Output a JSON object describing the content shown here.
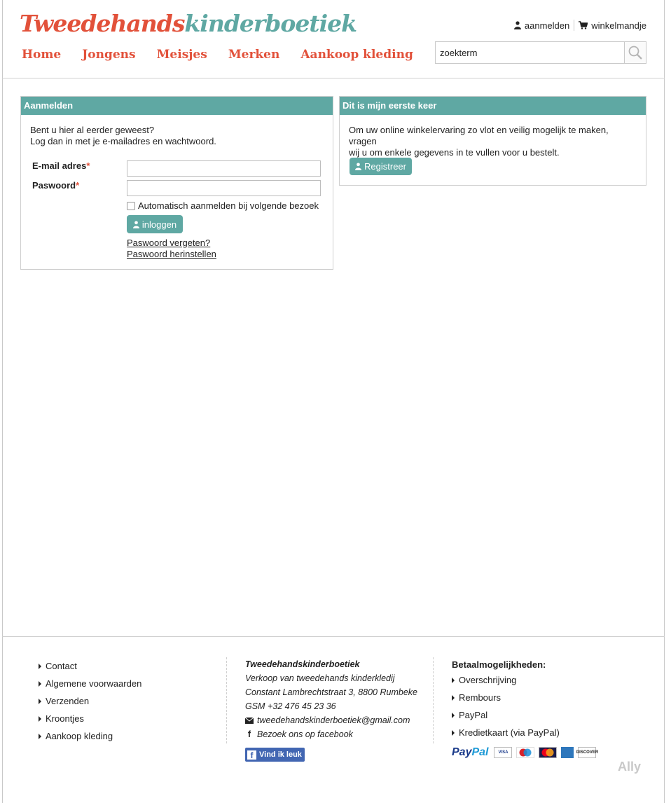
{
  "header": {
    "logo_part1": "Tweedehands",
    "logo_part2": "kinderboetiek",
    "nav": [
      "Home",
      "Jongens",
      "Meisjes",
      "Merken",
      "Aankoop kleding"
    ],
    "login_link": "aanmelden",
    "cart_link": "winkelmandje",
    "search_value": "zoekterm"
  },
  "login_panel": {
    "title": "Aanmelden",
    "intro_line1": "Bent u hier al eerder geweest?",
    "intro_line2": "Log dan in met je e-mailadres en wachtwoord.",
    "email_label": "E-mail adres",
    "password_label": "Paswoord",
    "required_mark": "*",
    "remember_label": "Automatisch aanmelden bij volgende bezoek",
    "login_button": "inloggen",
    "forgot_link": "Paswoord vergeten?",
    "reset_link": "Paswoord herinstellen"
  },
  "register_panel": {
    "title": "Dit is mijn eerste keer",
    "text_line1": "Om uw online winkelervaring zo vlot en veilig mogelijk te maken, vragen",
    "text_line2": "wij u om enkele gegevens in te vullen voor u bestelt.",
    "register_button": "Registreer"
  },
  "footer": {
    "links": [
      "Contact",
      "Algemene voorwaarden",
      "Verzenden",
      "Kroontjes",
      "Aankoop kleding"
    ],
    "company_name": "Tweedehandskinderboetiek",
    "description": "Verkoop van tweedehands kinderkledij",
    "address": "Constant Lambrechtstraat 3, 8800 Rumbeke",
    "phone": "GSM +32 476 45 23 36",
    "email": "tweedehandskinderboetiek@gmail.com",
    "facebook_text": "Bezoek ons op facebook",
    "like_button": "Vind ik leuk",
    "payment_title": "Betaalmogelijkheden:",
    "payment_methods": [
      "Overschrijving",
      "Rembours",
      "PayPal",
      "Kredietkaart (via PayPal)"
    ],
    "paypal_logo_1": "Pay",
    "paypal_logo_2": "Pal",
    "card_logos": [
      "VISA",
      "Maestro",
      "MasterCard",
      "AMEX",
      "DISCOVER"
    ],
    "maker_logo": "Ally"
  },
  "colors": {
    "brand_red": "#e2513a",
    "brand_teal": "#5fa8a3"
  }
}
